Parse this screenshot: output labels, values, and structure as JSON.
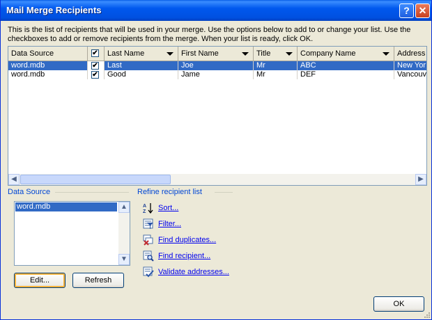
{
  "window": {
    "title": "Mail Merge Recipients",
    "help_icon": "?",
    "close_icon": "✕"
  },
  "intro": "This is the list of recipients that will be used in your merge.  Use the options below to add to or change your list.  Use the checkboxes to add or remove recipients from the merge.  When your list is ready, click OK.",
  "grid": {
    "columns": [
      "Data Source",
      "Last Name",
      "First Name",
      "Title",
      "Company Name",
      "Address"
    ],
    "rows": [
      {
        "source": "word.mdb",
        "checked": true,
        "last": "Last",
        "first": "Joe",
        "title": "Mr",
        "company": "ABC",
        "address": "New Yor",
        "selected": true
      },
      {
        "source": "word.mdb",
        "checked": true,
        "last": "Good",
        "first": "Jame",
        "title": "Mr",
        "company": "DEF",
        "address": "Vancouv",
        "selected": false
      }
    ],
    "check_mark": "✔"
  },
  "data_source": {
    "label": "Data Source",
    "items": [
      "word.mdb"
    ],
    "edit_label": "Edit...",
    "refresh_label": "Refresh"
  },
  "refine": {
    "label": "Refine recipient list",
    "links": [
      "Sort...",
      "Filter...",
      "Find duplicates...",
      "Find recipient...",
      "Validate addresses..."
    ]
  },
  "ok_label": "OK",
  "colors": {
    "selection": "#316ac5",
    "link": "#0000ee",
    "group_label": "#0046d5",
    "titlebar": "#0058ee"
  }
}
